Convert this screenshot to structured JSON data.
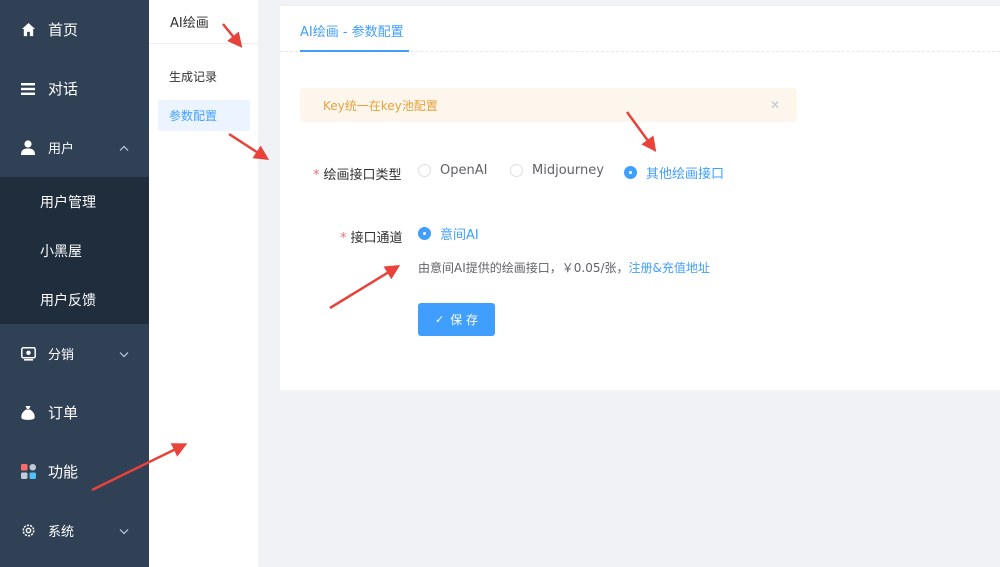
{
  "sidebar": {
    "items": [
      {
        "label": "首页",
        "icon": "home-icon"
      },
      {
        "label": "对话",
        "icon": "menu-lines-icon"
      },
      {
        "label": "用户",
        "icon": "user-icon"
      },
      {
        "label": "分销",
        "icon": "distribution-icon"
      },
      {
        "label": "订单",
        "icon": "money-bag-icon"
      },
      {
        "label": "功能",
        "icon": "grid-icon"
      },
      {
        "label": "系统",
        "icon": "gear-icon"
      }
    ],
    "user_submenu": [
      "用户管理",
      "小黑屋",
      "用户反馈"
    ]
  },
  "subpanel": {
    "title": "AI绘画",
    "items": [
      "生成记录",
      "参数配置"
    ]
  },
  "main": {
    "tab": "AI绘画 - 参数配置",
    "alert": "Key统一在key池配置",
    "interface_type": {
      "label": "绘画接口类型",
      "options": [
        "OpenAI",
        "Midjourney",
        "其他绘画接口"
      ],
      "selected": "其他绘画接口"
    },
    "channel": {
      "label": "接口通道",
      "option": "意间AI"
    },
    "desc_text": "由意间AI提供的绘画接口，￥0.05/张，",
    "desc_link": "注册&充值地址",
    "save_label": "保 存"
  },
  "colors": {
    "sidebar_bg": "#304156",
    "submenu_bg": "#1f2d3d",
    "accent": "#409eff",
    "warning": "#e6a23c",
    "arrow": "#e8423a"
  }
}
